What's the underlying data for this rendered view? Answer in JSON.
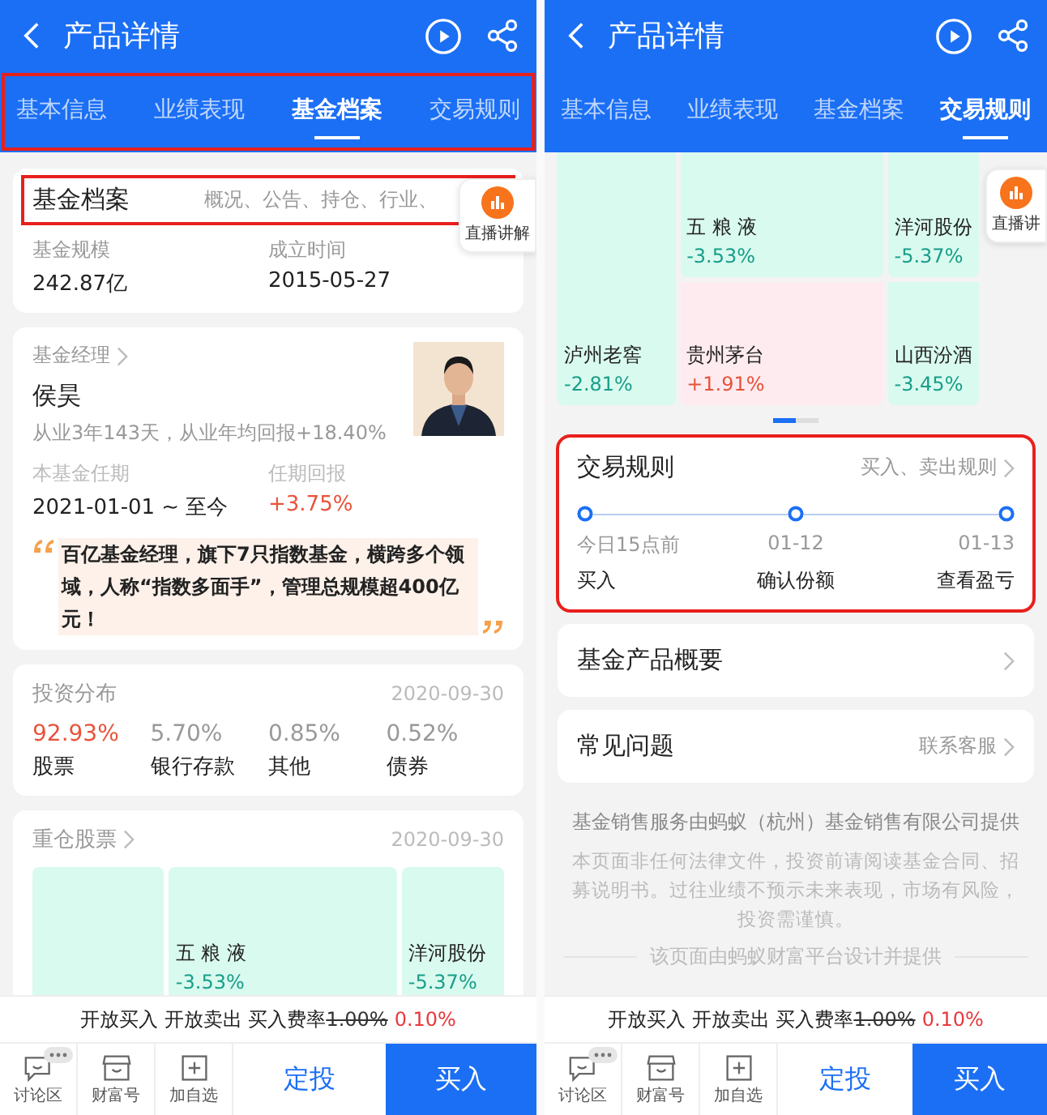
{
  "left_screen": {
    "header": {
      "title": "产品详情",
      "highlighted": true,
      "tabs": [
        {
          "label": "基本信息",
          "selected": false
        },
        {
          "label": "业绩表现",
          "selected": false
        },
        {
          "label": "基金档案",
          "selected": true
        },
        {
          "label": "交易规则",
          "selected": false
        }
      ]
    },
    "archive_card": {
      "title": "基金档案",
      "subtitle": "概况、公告、持仓、行业、",
      "highlighted": true,
      "facts": [
        {
          "label": "基金规模",
          "value": "242.87亿"
        },
        {
          "label": "成立时间",
          "value": "2015-05-27"
        }
      ]
    },
    "live_button": {
      "label": "直播讲解"
    },
    "manager_card": {
      "title": "基金经理",
      "name": "侯昊",
      "summary": "从业3年143天，从业年均回报+18.40%",
      "stats": [
        {
          "label": "本基金任期",
          "value": "2021-01-01 ~ 至今",
          "positive": false
        },
        {
          "label": "任期回报",
          "value": "+3.75%",
          "positive": true
        }
      ],
      "quote": "百亿基金经理，旗下7只指数基金，横跨多个领域，人称“指数多面手”，管理总规模超400亿元！"
    },
    "allocation_card": {
      "title": "投资分布",
      "date": "2020-09-30",
      "items": [
        {
          "value": "92.93%",
          "label": "股票",
          "emphasized": true
        },
        {
          "value": "5.70%",
          "label": "银行存款",
          "emphasized": false
        },
        {
          "value": "0.85%",
          "label": "其他",
          "emphasized": false
        },
        {
          "value": "0.52%",
          "label": "债券",
          "emphasized": false
        }
      ]
    },
    "holdings_card": {
      "title": "重仓股票",
      "date": "2020-09-30",
      "columns": [
        [
          {
            "color": "#d9faef"
          }
        ],
        [
          {
            "name": "五 粮 液",
            "change": "-3.53%",
            "positive": false,
            "color": "#d9faef"
          }
        ],
        [
          {
            "name": "洋河股份",
            "change": "-5.37%",
            "positive": false,
            "color": "#d9faef"
          }
        ]
      ]
    },
    "footer": {
      "fee": {
        "prefix": "开放买入 开放卖出 买入费率",
        "old": "1.00%",
        "new": "0.10%"
      },
      "nav": [
        {
          "label": "讨论区",
          "kind": "chat",
          "has_more": true
        },
        {
          "label": "财富号",
          "kind": "store",
          "has_more": false
        },
        {
          "label": "加自选",
          "kind": "add",
          "has_more": false
        }
      ],
      "buttons": [
        {
          "label": "定投",
          "kind": "secondary"
        },
        {
          "label": "买入",
          "kind": "primary"
        }
      ]
    }
  },
  "right_screen": {
    "header": {
      "title": "产品详情",
      "highlighted": false,
      "tabs": [
        {
          "label": "基本信息",
          "selected": false
        },
        {
          "label": "业绩表现",
          "selected": false
        },
        {
          "label": "基金档案",
          "selected": false
        },
        {
          "label": "交易规则",
          "selected": true
        }
      ]
    },
    "holdings": {
      "columns": [
        [
          {
            "name": "泸州老窖",
            "change": "-2.81%",
            "positive": false,
            "color": "#d9faef"
          }
        ],
        [
          {
            "name": "五 粮 液",
            "change": "-3.53%",
            "positive": false,
            "color": "#d9faef"
          },
          {
            "name": "贵州茅台",
            "change": "+1.91%",
            "positive": true,
            "color": "#fdebef"
          }
        ],
        [
          {
            "name": "洋河股份",
            "change": "-5.37%",
            "positive": false,
            "color": "#d9faef"
          },
          {
            "name": "山西汾酒",
            "change": "-3.45%",
            "positive": false,
            "color": "#d9faef"
          }
        ]
      ]
    },
    "pager": [
      {
        "selected": true
      },
      {
        "selected": false
      }
    ],
    "live_button": {
      "label": "直播讲"
    },
    "rules_card": {
      "title": "交易规则",
      "link": "买入、卖出规则",
      "highlighted": true,
      "steps": [
        {
          "time": "今日15点前",
          "action": "买入"
        },
        {
          "time": "01-12",
          "action": "确认份额"
        },
        {
          "time": "01-13",
          "action": "查看盈亏"
        }
      ]
    },
    "menu_rows": [
      {
        "title": "基金产品概要"
      },
      {
        "title": "常见问题",
        "link": "联系客服"
      }
    ],
    "footer_note": {
      "provider": "基金销售服务由蚂蚁（杭州）基金销售有限公司提供",
      "disclaimer": "本页面非任何法律文件，投资前请阅读基金合同、招募说明书。过往业绩不预示未来表现，市场有风险，投资需谨慎。",
      "credit": "该页面由蚂蚁财富平台设计并提供"
    },
    "footer": {
      "fee": {
        "prefix": "开放买入 开放卖出 买入费率",
        "old": "1.00%",
        "new": "0.10%"
      },
      "nav": [
        {
          "label": "讨论区",
          "kind": "chat",
          "has_more": true
        },
        {
          "label": "财富号",
          "kind": "store",
          "has_more": false
        },
        {
          "label": "加自选",
          "kind": "add",
          "has_more": false
        }
      ],
      "buttons": [
        {
          "label": "定投",
          "kind": "secondary"
        },
        {
          "label": "买入",
          "kind": "primary"
        }
      ]
    }
  }
}
